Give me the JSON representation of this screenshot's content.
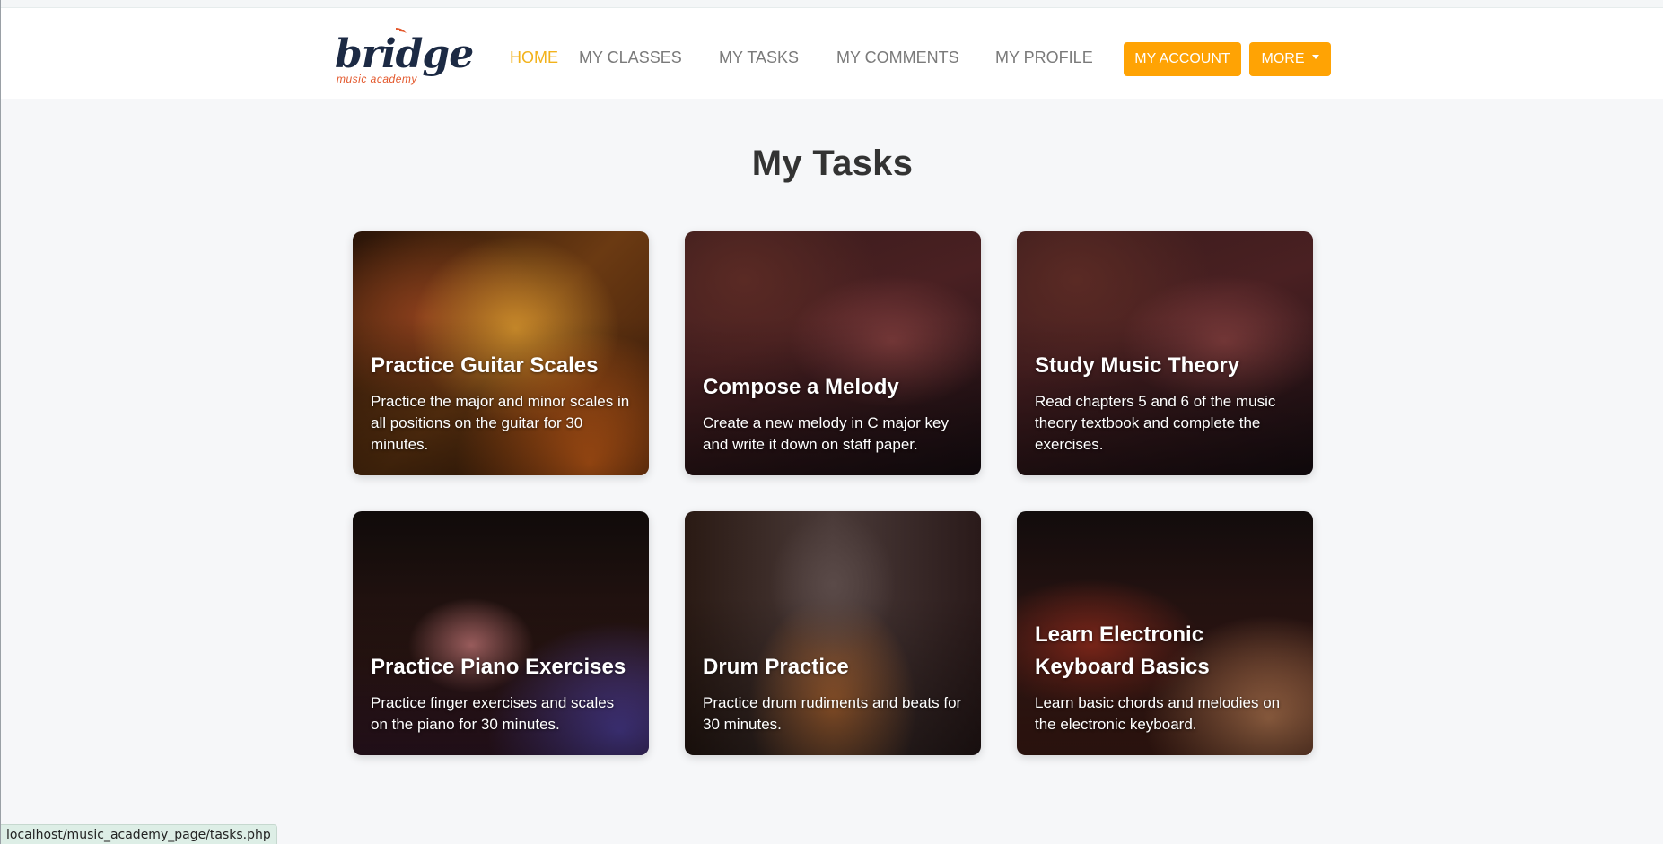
{
  "brand": {
    "name": "bridge",
    "tagline": "music academy"
  },
  "nav": {
    "items": [
      {
        "label": "HOME",
        "active": true
      },
      {
        "label": "MY CLASSES",
        "active": false
      },
      {
        "label": "MY TASKS",
        "active": false
      },
      {
        "label": "MY COMMENTS",
        "active": false
      },
      {
        "label": "MY PROFILE",
        "active": false
      }
    ],
    "account_label": "MY ACCOUNT",
    "more_label": "MORE"
  },
  "page": {
    "title": "My Tasks"
  },
  "tasks": [
    {
      "title": "Practice Guitar Scales",
      "description": "Practice the major and minor scales in all positions on the guitar for 30 minutes."
    },
    {
      "title": "Compose a Melody",
      "description": "Create a new melody in C major key and write it down on staff paper."
    },
    {
      "title": "Study Music Theory",
      "description": "Read chapters 5 and 6 of the music theory textbook and complete the exercises."
    },
    {
      "title": "Practice Piano Exercises",
      "description": "Practice finger exercises and scales on the piano for 30 minutes."
    },
    {
      "title": "Drum Practice",
      "description": "Practice drum rudiments and beats for 30 minutes."
    },
    {
      "title": "Learn Electronic Keyboard Basics",
      "description": "Learn basic chords and melodies on the electronic keyboard."
    }
  ],
  "status_bar": {
    "url": "localhost/music_academy_page/tasks.php"
  },
  "colors": {
    "accent": "#ffa304",
    "active_link": "#f2b21b",
    "brand_navy": "#1c2a44",
    "brand_orange": "#e3572b"
  }
}
